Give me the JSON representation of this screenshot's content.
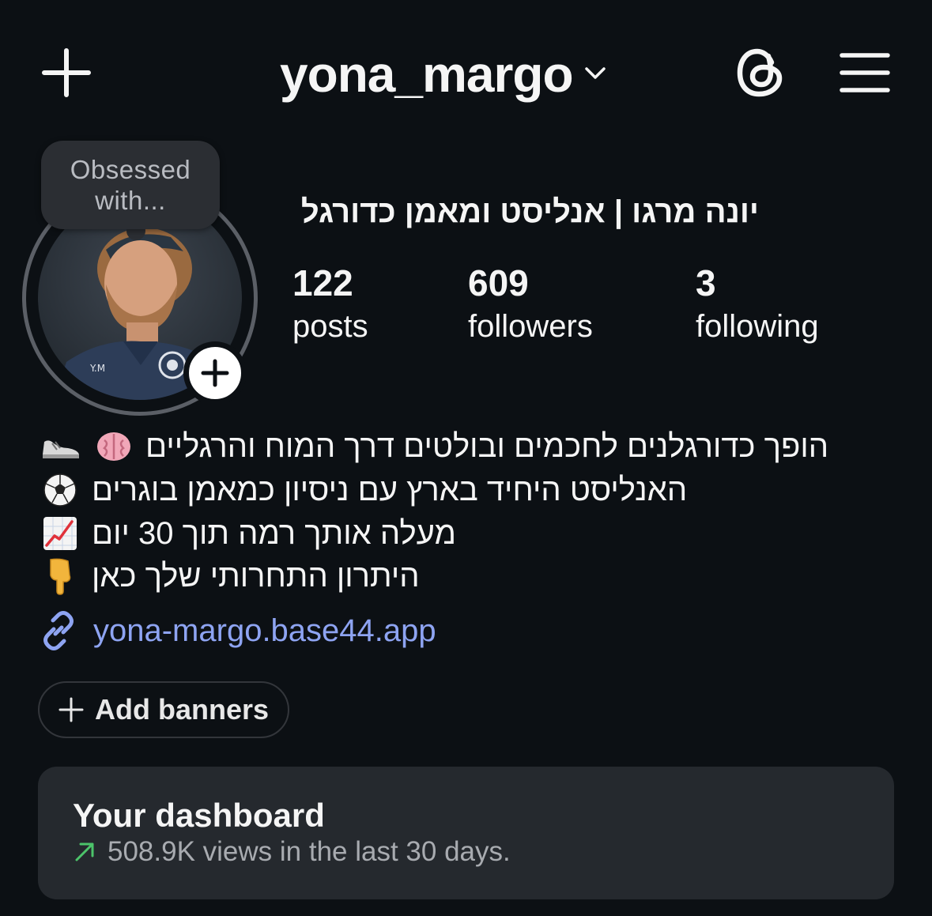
{
  "header": {
    "username": "yona_margo",
    "icons": {
      "create": "plus-icon",
      "account_switch": "chevron-down-icon",
      "threads": "threads-icon",
      "menu": "hamburger-menu-icon"
    }
  },
  "profile": {
    "note": {
      "line1": "Obsessed",
      "line2": "with..."
    },
    "avatar_badge_text": "Y.M",
    "display_name": "יונה מרגו | אנליסט ומאמן כדורגל",
    "stats": [
      {
        "value": "122",
        "label": "posts"
      },
      {
        "value": "609",
        "label": "followers"
      },
      {
        "value": "3",
        "label": "following"
      }
    ],
    "bio": [
      {
        "text": "הופך כדורגלנים לחכמים ובולטים דרך המוח והרגליים",
        "emojis": "🧠👟"
      },
      {
        "text": "האנליסט היחיד בארץ עם ניסיון כמאמן בוגרים",
        "emojis": "⚽"
      },
      {
        "text": "מעלה אותך רמה תוך 30 יום",
        "emojis": "📈"
      },
      {
        "text": "היתרון התחרותי שלך כאן",
        "emojis": "👇"
      }
    ],
    "link": "yona-margo.base44.app",
    "add_banners_label": "Add banners"
  },
  "dashboard": {
    "title": "Your dashboard",
    "subtitle": "508.9K views in the last 30 days."
  },
  "colors": {
    "background": "#0c1014",
    "card": "#25292e",
    "link": "#8ea4f2",
    "trend_up": "#4cc46a",
    "muted_text": "#a8abb0"
  }
}
